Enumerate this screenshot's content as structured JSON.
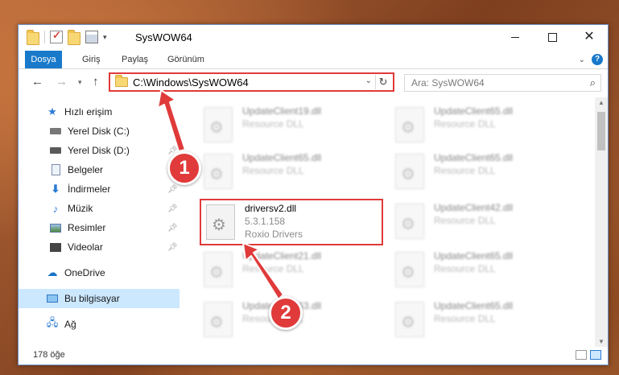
{
  "window": {
    "title": "SysWOW64"
  },
  "ribbon": {
    "tabs": [
      "Dosya",
      "Giriş",
      "Paylaş",
      "Görünüm"
    ]
  },
  "address": {
    "path": "C:\\Windows\\SysWOW64"
  },
  "search": {
    "placeholder": "Ara: SysWOW64"
  },
  "nav": {
    "items": [
      {
        "label": "Hızlı erişim",
        "icon": "star-icon",
        "pinned": false
      },
      {
        "label": "Yerel Disk (C:)",
        "icon": "drive-icon",
        "pinned": false
      },
      {
        "label": "Yerel Disk (D:)",
        "icon": "drive-icon",
        "pinned": true
      },
      {
        "label": "Belgeler",
        "icon": "documents-icon",
        "pinned": true
      },
      {
        "label": "İndirmeler",
        "icon": "downloads-icon",
        "pinned": true
      },
      {
        "label": "Müzik",
        "icon": "music-icon",
        "pinned": true
      },
      {
        "label": "Resimler",
        "icon": "pictures-icon",
        "pinned": true
      },
      {
        "label": "Videolar",
        "icon": "videos-icon",
        "pinned": true
      },
      {
        "label": "OneDrive",
        "icon": "onedrive-icon",
        "pinned": false
      },
      {
        "label": "Bu bilgisayar",
        "icon": "this-pc-icon",
        "pinned": false,
        "selected": true
      },
      {
        "label": "Ağ",
        "icon": "network-icon",
        "pinned": false
      }
    ]
  },
  "files": {
    "col1": [
      {
        "name": "UpdateClient19.dll",
        "type": "Resource DLL"
      },
      {
        "name": "UpdateClient65.dll",
        "type": "Resource DLL"
      },
      {
        "name": "UpdateClient21.dll",
        "type": "Resource DLL"
      },
      {
        "name": "UpdateClient63.dll",
        "type": "Resource DLL"
      }
    ],
    "col2": [
      {
        "name": "UpdateClient65.dll",
        "type": "Resource DLL"
      },
      {
        "name": "UpdateClient65.dll",
        "type": "Resource DLL"
      },
      {
        "name": "UpdateClient42.dll",
        "type": "Resource DLL"
      },
      {
        "name": "UpdateClient65.dll",
        "type": "Resource DLL"
      },
      {
        "name": "UpdateClient65.dll",
        "type": "Resource DLL"
      }
    ],
    "highlighted": {
      "name": "driversv2.dll",
      "version": "5.3.1.158",
      "company": "Roxio Drivers"
    }
  },
  "status": {
    "count": "178 öğe"
  },
  "callouts": {
    "one": "1",
    "two": "2"
  },
  "colors": {
    "accent": "#1979ca",
    "highlight": "#e03a3a",
    "selection": "#cce8ff"
  }
}
